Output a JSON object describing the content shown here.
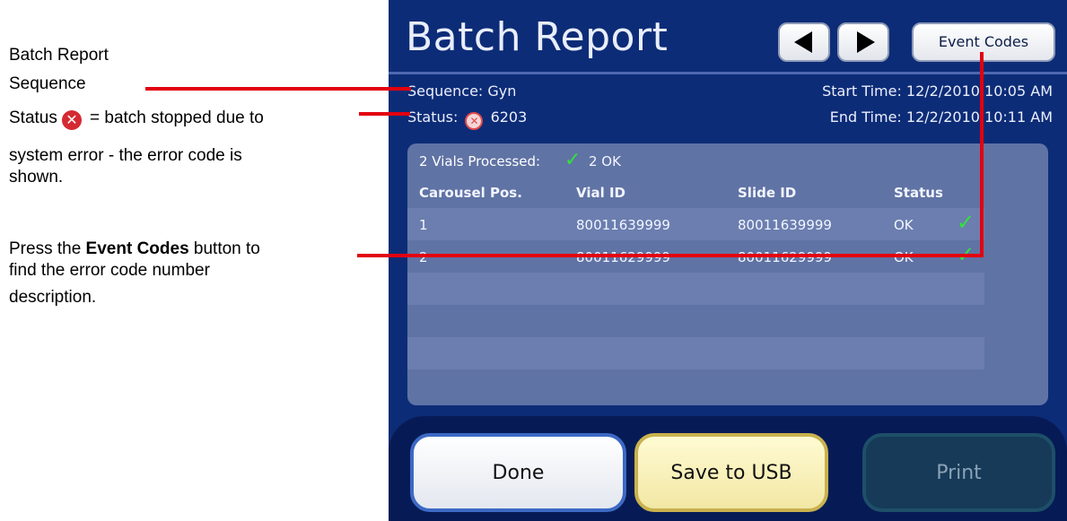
{
  "annotations": {
    "sequence_label_line1": "Batch Report",
    "sequence_label_line2": "Sequence",
    "status_prefix": "Status",
    "status_suffix": "= batch stopped due to",
    "status_line2": "system error - the error code is",
    "status_line3": "shown.",
    "event_pre": "Press the",
    "event_bold": "Event Codes",
    "event_post": "button to",
    "event_line2": "find the error code number",
    "event_line3": "description."
  },
  "screen": {
    "title": "Batch Report",
    "event_codes_label": "Event Codes",
    "sequence": "Sequence: Gyn",
    "status_label": "Status:",
    "status_code": "6203",
    "start_time_label": "Start Time:",
    "start_time_value": "12/2/2010 10:05 AM",
    "end_time_label": "End Time:",
    "end_time_value": "12/2/2010 10:11 AM",
    "summary_processed": "2 Vials Processed:",
    "summary_ok": "2 OK",
    "columns": [
      "Carousel Pos.",
      "Vial ID",
      "Slide ID",
      "Status"
    ],
    "rows": [
      {
        "pos": "1",
        "vial": "80011639999",
        "slide": "80011639999",
        "status": "OK"
      },
      {
        "pos": "2",
        "vial": "80011629999",
        "slide": "80011629999",
        "status": "OK"
      }
    ],
    "done_label": "Done",
    "save_label": "Save to USB",
    "print_label": "Print"
  },
  "colors": {
    "callout": "#e3000f",
    "screen_bg": "#0d2c77",
    "ok_check": "#32e23a",
    "error_icon": "#d42a32"
  },
  "icons": [
    "error-x-icon",
    "checkmark-icon",
    "arrow-left-icon",
    "arrow-right-icon"
  ]
}
